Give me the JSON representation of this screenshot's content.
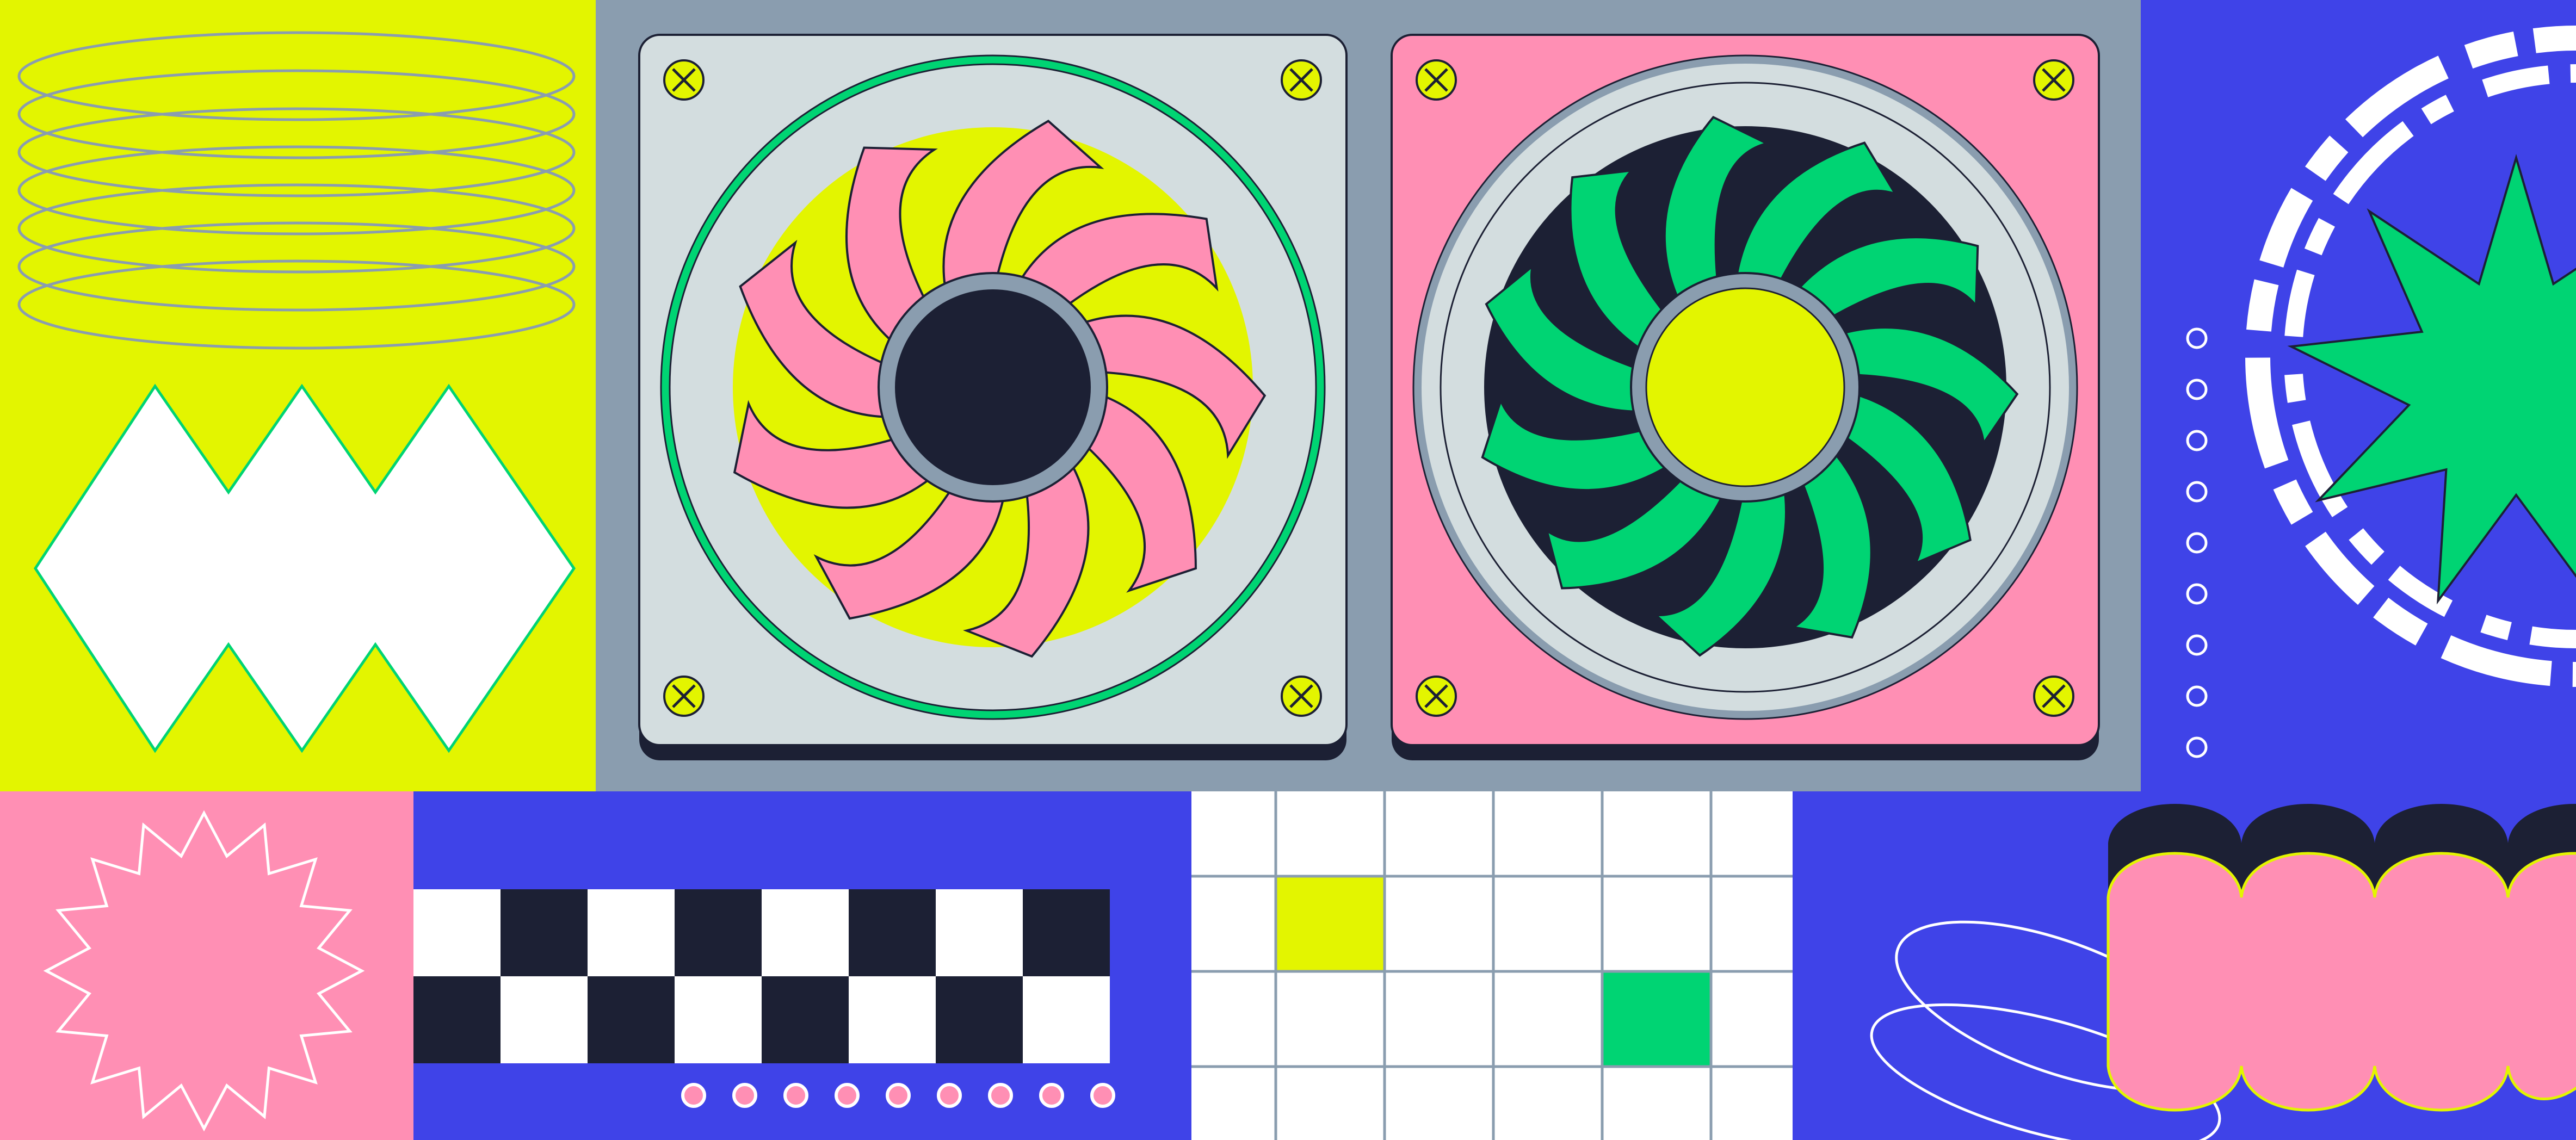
{
  "title": "",
  "palette": {
    "lime": "#e3f500",
    "slate": "#8a9daf",
    "blue": "#3f43e8",
    "pink": "#ff8fb4",
    "navy": "#1c2034",
    "green": "#00d473",
    "panel_gray": "#d3dddf",
    "white": "#ffffff"
  },
  "panels": {
    "fan_left": {
      "plate_color": "#d3dddf",
      "blade_color": "#ff8fb4",
      "back_color": "#e3f500",
      "hub_color": "#1c2034",
      "ring_color": "#00d473",
      "blade_count": 9
    },
    "fan_right": {
      "plate_color": "#ff8fb4",
      "blade_color": "#00d473",
      "back_color": "#1c2034",
      "hub_color": "#e3f500",
      "ring_color": "#8a9daf",
      "blade_count": 11
    }
  },
  "icons": [
    "screw-icon",
    "starburst-icon",
    "wave-ring-icon",
    "zigzag-shape-icon",
    "checkerboard-icon",
    "dotted-ring-icon",
    "scallop-shape-icon",
    "ellipse-orbit-icon"
  ],
  "grid_tiles": {
    "columns": 6,
    "rows": 4,
    "filled": [
      {
        "col": 1,
        "row": 1,
        "color": "#e3f500"
      },
      {
        "col": 4,
        "row": 2,
        "color": "#00d473"
      }
    ]
  },
  "dots": {
    "vertical_count": 9,
    "horizontal_count": 9
  }
}
